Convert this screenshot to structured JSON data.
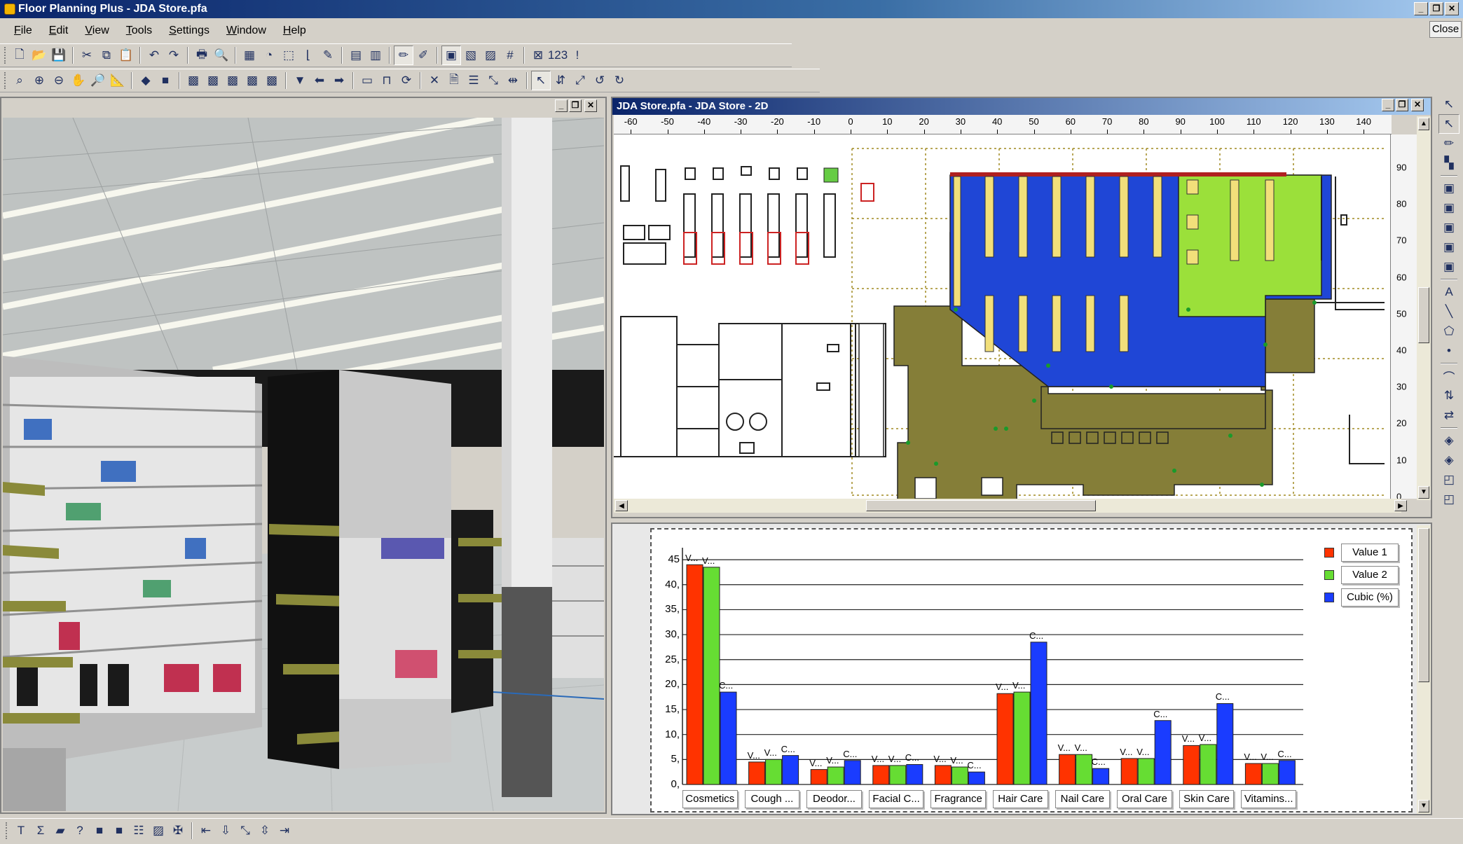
{
  "window": {
    "title": "Floor Planning Plus - JDA Store.pfa",
    "close_label": "Close",
    "min_glyph": "_",
    "restore_glyph": "❐",
    "close_glyph": "✕"
  },
  "menu": [
    "File",
    "Edit",
    "View",
    "Tools",
    "Settings",
    "Window",
    "Help"
  ],
  "toolbar1": [
    {
      "name": "new-icon",
      "g": "🗋"
    },
    {
      "name": "open-icon",
      "g": "📂"
    },
    {
      "name": "save-icon",
      "g": "💾"
    },
    {
      "name": "cut-icon",
      "g": "✂"
    },
    {
      "name": "copy-icon",
      "g": "⧉"
    },
    {
      "name": "paste-icon",
      "g": "📋"
    },
    {
      "name": "undo-icon",
      "g": "↶"
    },
    {
      "name": "redo-icon",
      "g": "↷"
    },
    {
      "name": "print-icon",
      "g": "🖶"
    },
    {
      "name": "print-preview-icon",
      "g": "🔍"
    },
    {
      "name": "table-icon",
      "g": "▦"
    },
    {
      "name": "pie-chart-icon",
      "g": "◔"
    },
    {
      "name": "select-area-icon",
      "g": "⬚"
    },
    {
      "name": "fixture-l-icon",
      "g": "⌊"
    },
    {
      "name": "fixture-edit-icon",
      "g": "✎"
    },
    {
      "name": "report-icon",
      "g": "▤"
    },
    {
      "name": "layer-icon",
      "g": "▥"
    },
    {
      "name": "pencil-icon",
      "g": "✏"
    },
    {
      "name": "edit-box-icon",
      "g": "✐"
    },
    {
      "name": "fill-red-icon",
      "g": "▣"
    },
    {
      "name": "pattern-icon",
      "g": "▧"
    },
    {
      "name": "hatch-icon",
      "g": "▨"
    },
    {
      "name": "grid-icon",
      "g": "#"
    },
    {
      "name": "delete-x-icon",
      "g": "⊠"
    },
    {
      "name": "numbering-icon",
      "g": "123"
    },
    {
      "name": "alert-icon",
      "g": "!"
    }
  ],
  "toolbar2": [
    {
      "name": "zoom-fit-icon",
      "g": "⌕"
    },
    {
      "name": "zoom-in-icon",
      "g": "⊕"
    },
    {
      "name": "zoom-out-icon",
      "g": "⊖"
    },
    {
      "name": "zoom-pan-icon",
      "g": "✋"
    },
    {
      "name": "zoom-window-icon",
      "g": "🔎"
    },
    {
      "name": "measure-icon",
      "g": "📐"
    },
    {
      "name": "layer-green-1-icon",
      "g": "◆"
    },
    {
      "name": "layer-green-2-icon",
      "g": "■"
    },
    {
      "name": "block-1-icon",
      "g": "▩"
    },
    {
      "name": "block-2-icon",
      "g": "▩"
    },
    {
      "name": "block-3-icon",
      "g": "▩"
    },
    {
      "name": "block-4-icon",
      "g": "▩"
    },
    {
      "name": "block-5-icon",
      "g": "▩"
    },
    {
      "name": "filter-icon",
      "g": "▼"
    },
    {
      "name": "arrow-left-icon",
      "g": "⬅"
    },
    {
      "name": "arrow-right-icon",
      "g": "➡"
    },
    {
      "name": "align-1-icon",
      "g": "▭"
    },
    {
      "name": "align-2-icon",
      "g": "⊓"
    },
    {
      "name": "rotate-icon",
      "g": "⟳"
    },
    {
      "name": "cross-icon",
      "g": "✕"
    },
    {
      "name": "doc-icon",
      "g": "🗎"
    },
    {
      "name": "list-icon",
      "g": "☰"
    },
    {
      "name": "resize-icon",
      "g": "⤡"
    },
    {
      "name": "split-icon",
      "g": "⇹"
    },
    {
      "name": "pointer-icon",
      "g": "↖"
    },
    {
      "name": "distribute-icon",
      "g": "⇵"
    },
    {
      "name": "expand-icon",
      "g": "⤢"
    },
    {
      "name": "rotate-ccw-icon",
      "g": "↺"
    },
    {
      "name": "rotate-cw-icon",
      "g": "↻"
    }
  ],
  "view2d": {
    "title": "JDA Store.pfa - JDA Store - 2D",
    "ruler_x": [
      -60,
      -50,
      -40,
      -30,
      -20,
      -10,
      0,
      10,
      20,
      30,
      40,
      50,
      60,
      70,
      80,
      90,
      100,
      110,
      120,
      130,
      140
    ],
    "ruler_y": [
      90,
      80,
      70,
      60,
      50,
      40,
      30,
      20,
      10,
      0
    ]
  },
  "chart_data": {
    "type": "bar",
    "categories": [
      "Cosmetics",
      "Cough ...",
      "Deodor...",
      "Facial C...",
      "Fragrance",
      "Hair Care",
      "Nail Care",
      "Oral Care",
      "Skin Care",
      "Vitamins..."
    ],
    "series": [
      {
        "name": "Value 1",
        "color": "#ff3300",
        "label": "V...",
        "values": [
          44,
          4.5,
          3,
          3.8,
          3.8,
          18.2,
          6,
          5.2,
          7.8,
          4.2
        ]
      },
      {
        "name": "Value 2",
        "color": "#66dd33",
        "label": "V...",
        "values": [
          43.5,
          5,
          3.5,
          3.8,
          3.5,
          18.5,
          6,
          5.2,
          8,
          4.2
        ]
      },
      {
        "name": "Cubic (%)",
        "color": "#1a3cff",
        "label": "C...",
        "values": [
          18.5,
          5.8,
          4.8,
          4,
          2.5,
          28.5,
          3.2,
          12.8,
          16.2,
          4.8
        ]
      }
    ],
    "yticks": [
      "45",
      "40,",
      "35,",
      "30,",
      "25,",
      "20,",
      "15,",
      "10,",
      "5,",
      "0,"
    ],
    "ylim": [
      0,
      46
    ],
    "legend": "top-right",
    "grid": true
  },
  "vtoolbar": [
    {
      "name": "select-arrow-icon",
      "g": "↖"
    },
    {
      "name": "select-active-icon",
      "g": "↖"
    },
    {
      "name": "draw-pencil-icon",
      "g": "✏"
    },
    {
      "name": "group-icon",
      "g": "▚"
    },
    {
      "name": "fixture-1-icon",
      "g": "▣"
    },
    {
      "name": "fixture-2-icon",
      "g": "▣"
    },
    {
      "name": "fixture-3-icon",
      "g": "▣"
    },
    {
      "name": "fixture-4-icon",
      "g": "▣"
    },
    {
      "name": "fixture-5-icon",
      "g": "▣"
    },
    {
      "name": "text-tool-icon",
      "g": "A"
    },
    {
      "name": "line-tool-icon",
      "g": "╲"
    },
    {
      "name": "polygon-tool-icon",
      "g": "⬠"
    },
    {
      "name": "marker-icon",
      "g": "•"
    },
    {
      "name": "node-icon",
      "g": "⌒"
    },
    {
      "name": "transform-icon",
      "g": "⇅"
    },
    {
      "name": "swap-icon",
      "g": "⇄"
    },
    {
      "name": "layer-a-icon",
      "g": "◈"
    },
    {
      "name": "layer-b-icon",
      "g": "◈"
    },
    {
      "name": "layer-c-icon",
      "g": "◰"
    },
    {
      "name": "layer-d-icon",
      "g": "◰"
    }
  ],
  "bottombar": [
    {
      "name": "text-format-icon",
      "g": "T"
    },
    {
      "name": "sum-icon",
      "g": "Σ"
    },
    {
      "name": "fill-icon",
      "g": "▰"
    },
    {
      "name": "help-query-icon",
      "g": "?"
    },
    {
      "name": "gray-block-1-icon",
      "g": "■"
    },
    {
      "name": "gray-block-2-icon",
      "g": "■"
    },
    {
      "name": "bullet-list-icon",
      "g": "☷"
    },
    {
      "name": "image-icon",
      "g": "▨"
    },
    {
      "name": "tools-icon",
      "g": "✠"
    },
    {
      "name": "move-first-icon",
      "g": "⇤"
    },
    {
      "name": "move-down-icon",
      "g": "⇩"
    },
    {
      "name": "move-diag-icon",
      "g": "⤡"
    },
    {
      "name": "move-updown-icon",
      "g": "⇳"
    },
    {
      "name": "move-last-icon",
      "g": "⇥"
    }
  ]
}
